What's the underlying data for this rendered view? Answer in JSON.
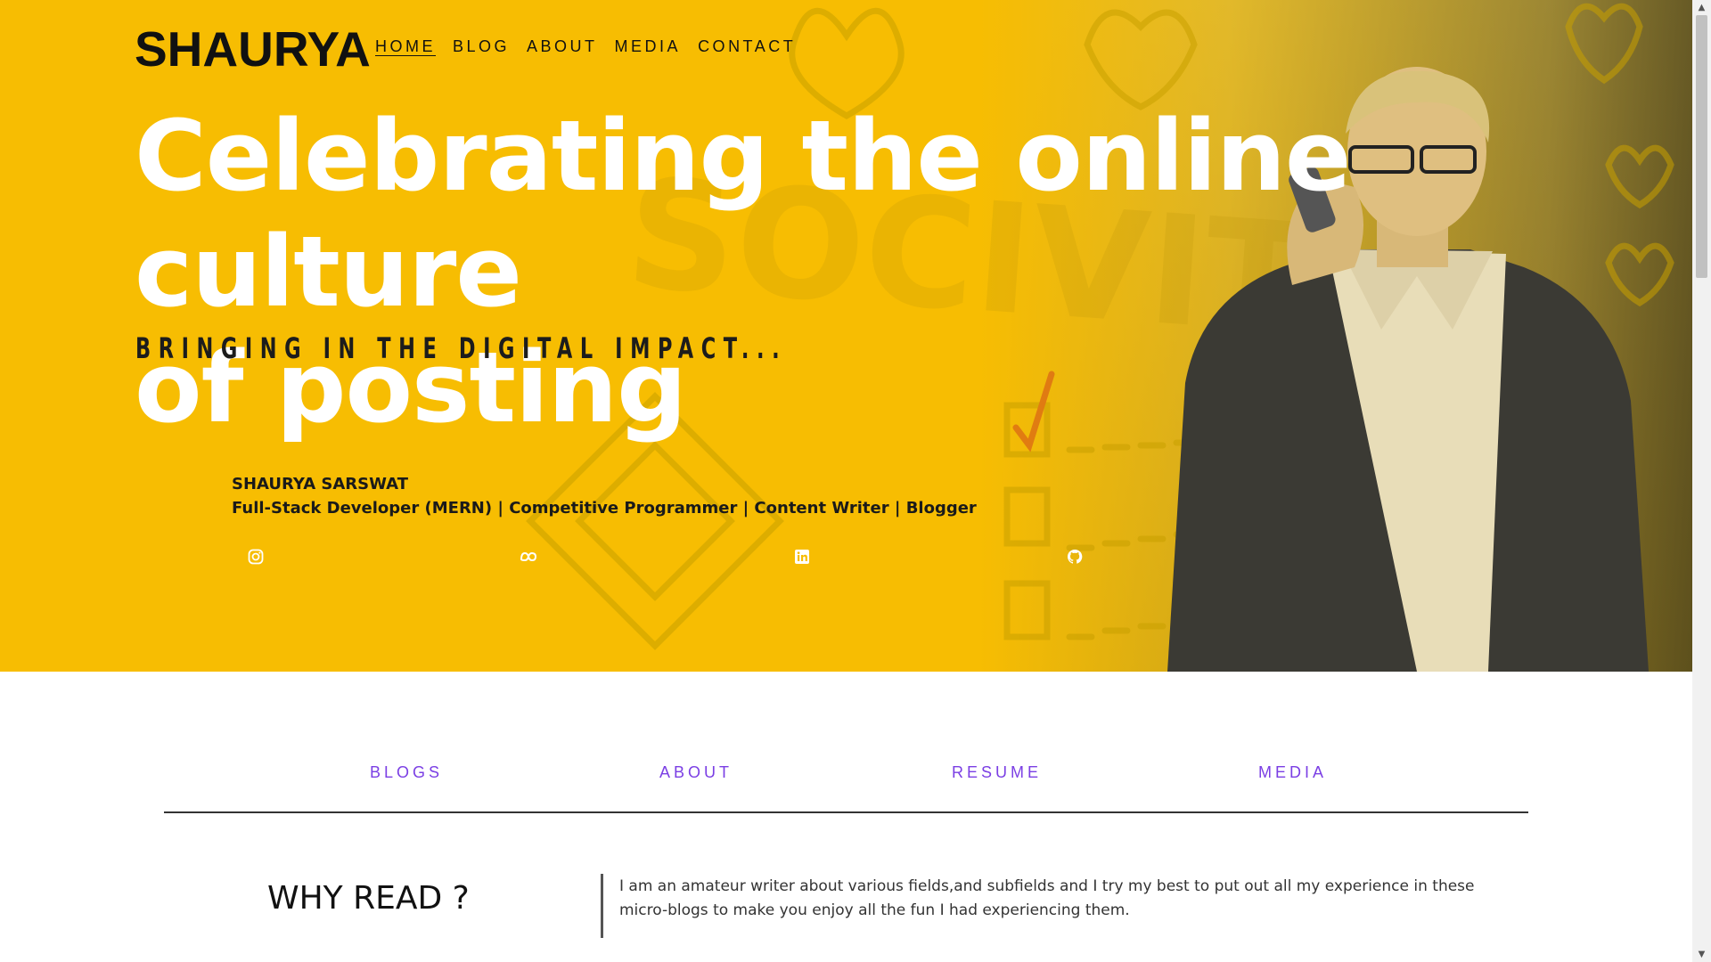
{
  "header": {
    "brand": "SHAURYA",
    "nav": [
      "HOME",
      "BLOG",
      "ABOUT",
      "MEDIA",
      "CONTACT"
    ],
    "active_nav": "HOME"
  },
  "hero": {
    "headline_line1": "Celebrating the online culture",
    "headline_line2": "of posting",
    "tagline": "BRINGING IN THE DIGITAL IMPACT...",
    "author_name": "SHAURYA SARSWAT",
    "author_role": "Full-Stack Developer (MERN) | Competitive Programmer | Content Writer | Blogger",
    "socials": [
      "instagram-icon",
      "meta-icon",
      "linkedin-icon",
      "github-icon"
    ],
    "accent_color": "#f7bd02"
  },
  "section_nav": {
    "items": [
      "BLOGS",
      "ABOUT",
      "RESUME",
      "MEDIA"
    ],
    "link_color": "#7b3fe4"
  },
  "why_read": {
    "title": "WHY READ ?",
    "text": "I am an amateur writer about various fields,and subfields and I try my best to put out all my experience in these micro-blogs to make you enjoy all the fun I had experiencing them."
  }
}
